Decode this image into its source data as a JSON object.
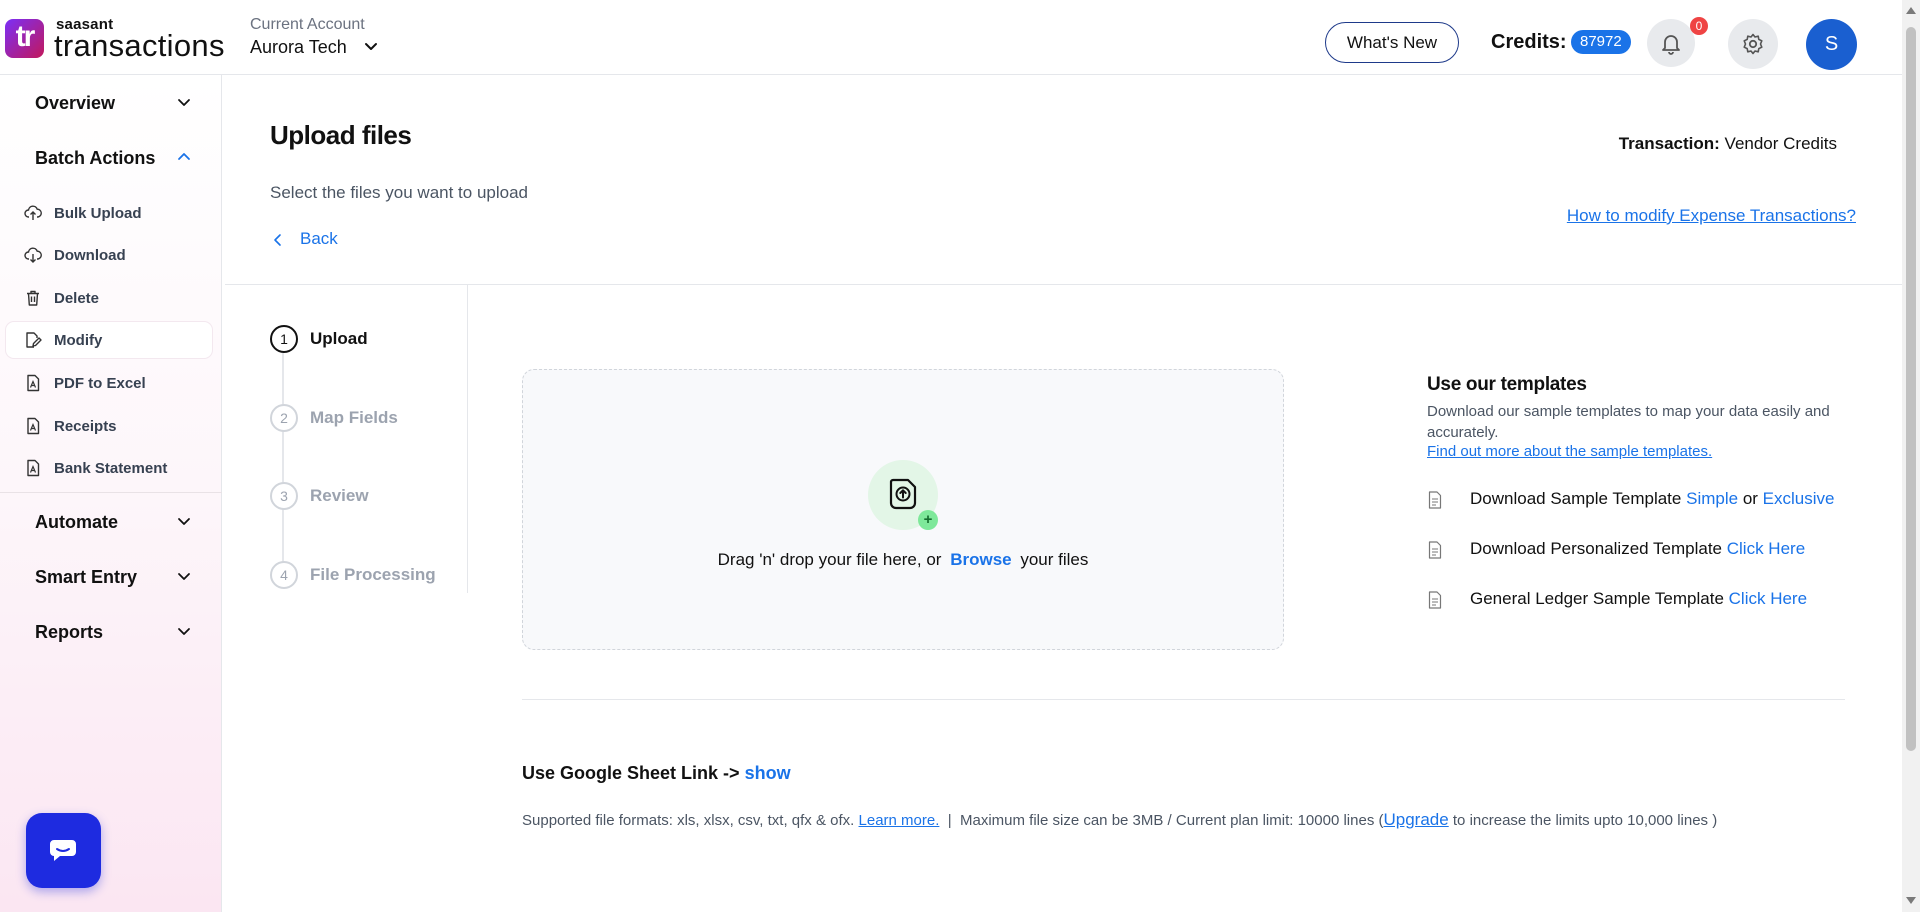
{
  "header": {
    "logo_mark": "tr",
    "logo_small": "saasant",
    "logo_big": "transactions",
    "account_label": "Current Account",
    "account_name": "Aurora Tech",
    "whats_new_label": "What's New",
    "credits_label": "Credits:",
    "credits_value": "87972",
    "notification_count": "0",
    "avatar_initial": "S"
  },
  "sidebar": {
    "groups": [
      {
        "label": "Overview",
        "expanded": false
      },
      {
        "label": "Batch Actions",
        "expanded": true
      },
      {
        "label": "Automate",
        "expanded": false
      },
      {
        "label": "Smart Entry",
        "expanded": false
      },
      {
        "label": "Reports",
        "expanded": false
      }
    ],
    "batch_items": [
      {
        "label": "Bulk Upload",
        "icon": "cloud-upload-icon"
      },
      {
        "label": "Download",
        "icon": "cloud-download-icon"
      },
      {
        "label": "Delete",
        "icon": "trash-icon"
      },
      {
        "label": "Modify",
        "icon": "edit-icon",
        "active": true
      },
      {
        "label": "PDF to Excel",
        "icon": "pdf-file-icon"
      },
      {
        "label": "Receipts",
        "icon": "receipt-file-icon"
      },
      {
        "label": "Bank Statement",
        "icon": "statement-file-icon"
      }
    ]
  },
  "main": {
    "title": "Upload files",
    "subtitle": "Select the files you want to upload",
    "back_label": "Back",
    "transaction_label": "Transaction:",
    "transaction_value": "Vendor Credits",
    "help_link": "How to modify Expense Transactions?"
  },
  "stepper": [
    {
      "num": "1",
      "label": "Upload",
      "active": true
    },
    {
      "num": "2",
      "label": "Map Fields",
      "active": false
    },
    {
      "num": "3",
      "label": "Review",
      "active": false
    },
    {
      "num": "4",
      "label": "File Processing",
      "active": false
    }
  ],
  "dropzone": {
    "text_before": "Drag 'n' drop your file here, or",
    "browse_label": "Browse",
    "text_after": "your files",
    "plus": "+"
  },
  "templates": {
    "title": "Use our templates",
    "description": "Download our sample templates to map your data easily and accurately.",
    "more_link": "Find out more about the sample templates.",
    "rows": [
      {
        "text": "Download Sample Template",
        "link1": "Simple",
        "joiner": "or",
        "link2": "Exclusive"
      },
      {
        "text": "Download Personalized Template",
        "link1": "Click Here"
      },
      {
        "text": "General Ledger Sample Template",
        "link1": "Click Here"
      }
    ]
  },
  "gsheet": {
    "label": "Use Google Sheet Link ->",
    "show_label": "show"
  },
  "footer": {
    "formats": "Supported file formats: xls, xlsx, csv, txt, qfx & ofx.",
    "learn_more": "Learn more.",
    "separator": "|",
    "limits": "Maximum file size can be 3MB / Current plan limit: 10000 lines (",
    "upgrade": "Upgrade",
    "limits_tail": "to increase the limits upto 10,000 lines )"
  },
  "colors": {
    "accent": "#1a73e8",
    "chat_button": "#1e2be0",
    "notification": "#ef4444",
    "avatar": "#1a5fd0"
  }
}
